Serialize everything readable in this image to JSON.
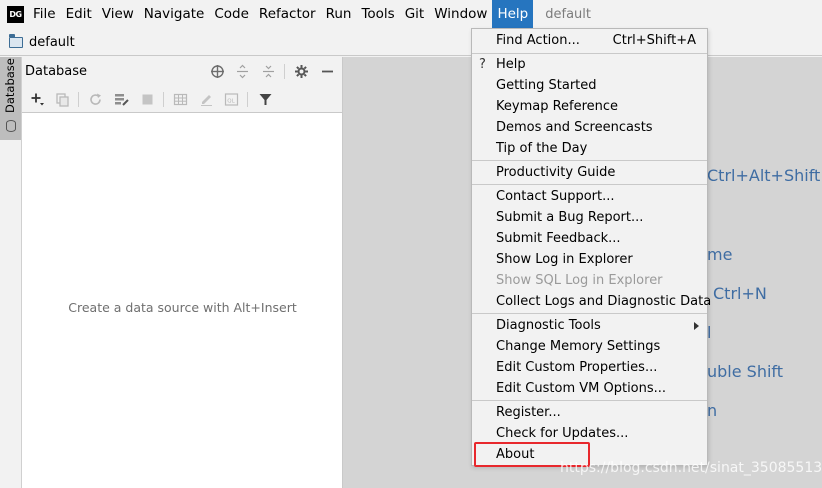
{
  "app": {
    "logo_text": "DG",
    "project_name": "default"
  },
  "menubar": {
    "items": [
      "File",
      "Edit",
      "View",
      "Navigate",
      "Code",
      "Refactor",
      "Run",
      "Tools",
      "Git",
      "Window",
      "Help"
    ],
    "active": "Help"
  },
  "breadcrumb": {
    "label": "default"
  },
  "tool_strip": {
    "database_tab": "Database"
  },
  "db_panel": {
    "title": "Database",
    "empty_text": "Create a data source with Alt+Insert"
  },
  "editor_hints": {
    "h1": "Ctrl+Alt+Shift+",
    "h2": "me",
    "h3": "Ctrl+N",
    "h4": "l",
    "h5": "uble Shift",
    "h6": "n"
  },
  "help_menu": {
    "items": [
      {
        "label": "Find Action...",
        "shortcut": "Ctrl+Shift+A"
      },
      {
        "label": "Help"
      },
      {
        "label": "Getting Started"
      },
      {
        "label": "Keymap Reference"
      },
      {
        "label": "Demos and Screencasts"
      },
      {
        "label": "Tip of the Day"
      },
      {
        "label": "Productivity Guide"
      },
      {
        "label": "Contact Support..."
      },
      {
        "label": "Submit a Bug Report..."
      },
      {
        "label": "Submit Feedback..."
      },
      {
        "label": "Show Log in Explorer"
      },
      {
        "label": "Show SQL Log in Explorer",
        "disabled": true
      },
      {
        "label": "Collect Logs and Diagnostic Data"
      },
      {
        "label": "Diagnostic Tools",
        "submenu": true
      },
      {
        "label": "Change Memory Settings"
      },
      {
        "label": "Edit Custom Properties..."
      },
      {
        "label": "Edit Custom VM Options..."
      },
      {
        "label": "Register..."
      },
      {
        "label": "Check for Updates..."
      },
      {
        "label": "About"
      }
    ]
  },
  "annotation": {
    "highlight_color": "#e8282d"
  },
  "watermark": "https://blog.csdn.net/sinat_35085513",
  "colors": {
    "accent": "#2675bf",
    "hint_text": "#3f6da3"
  }
}
